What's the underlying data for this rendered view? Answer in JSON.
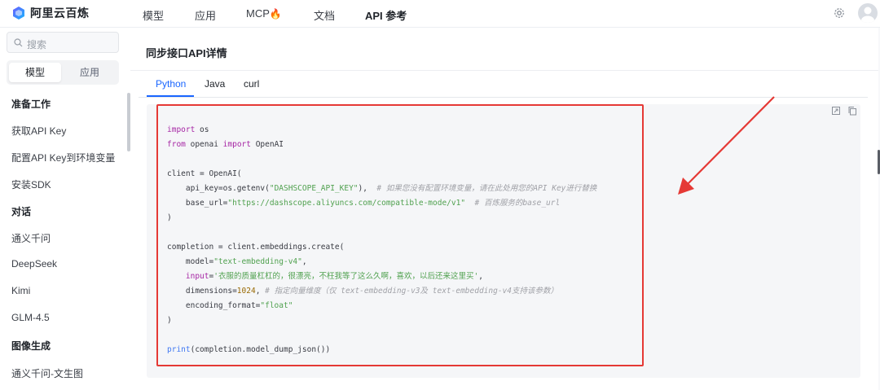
{
  "app": {
    "name": "阿里云百炼"
  },
  "nav": {
    "items": [
      "模型",
      "应用",
      "MCP",
      "文档",
      "API 参考"
    ],
    "mcp_badge": "🔥",
    "active": "API 参考"
  },
  "sidebar": {
    "search_placeholder": "搜索",
    "segments": [
      "模型",
      "应用"
    ],
    "active_segment": "模型",
    "items": [
      {
        "label": "准备工作",
        "group": true
      },
      {
        "label": "获取API Key",
        "group": false
      },
      {
        "label": "配置API Key到环境变量",
        "group": false
      },
      {
        "label": "安装SDK",
        "group": false
      },
      {
        "label": "对话",
        "group": true
      },
      {
        "label": "通义千问",
        "group": false
      },
      {
        "label": "DeepSeek",
        "group": false
      },
      {
        "label": "Kimi",
        "group": false
      },
      {
        "label": "GLM-4.5",
        "group": false
      },
      {
        "label": "图像生成",
        "group": true
      },
      {
        "label": "通义千问-文生图",
        "group": false
      }
    ]
  },
  "main": {
    "title": "同步接口API详情",
    "tabs": [
      "Python",
      "Java",
      "curl"
    ],
    "active_tab": "Python"
  },
  "code": {
    "lines": [
      "import os",
      "from openai import OpenAI",
      "",
      "client = OpenAI(",
      "    api_key=os.getenv(\"DASHSCOPE_API_KEY\"),  # 如果您没有配置环境变量，请在此处用您的API Key进行替换",
      "    base_url=\"https://dashscope.aliyuncs.com/compatible-mode/v1\"  # 百炼服务的base_url",
      ")",
      "",
      "completion = client.embeddings.create(",
      "    model=\"text-embedding-v4\",",
      "    input='衣服的质量杠杠的，很漂亮，不枉我等了这么久啊，喜欢，以后还来这里买',",
      "    dimensions=1024, # 指定向量维度（仅 text-embedding-v3及 text-embedding-v4支持该参数）",
      "    encoding_format=\"float\"",
      ")",
      "",
      "print(completion.model_dump_json())"
    ]
  },
  "colors": {
    "accent": "#1a66ff",
    "highlight_border": "#e53935",
    "keyword": "#a626a4",
    "string": "#50a14f",
    "comment": "#a0a1a7"
  }
}
